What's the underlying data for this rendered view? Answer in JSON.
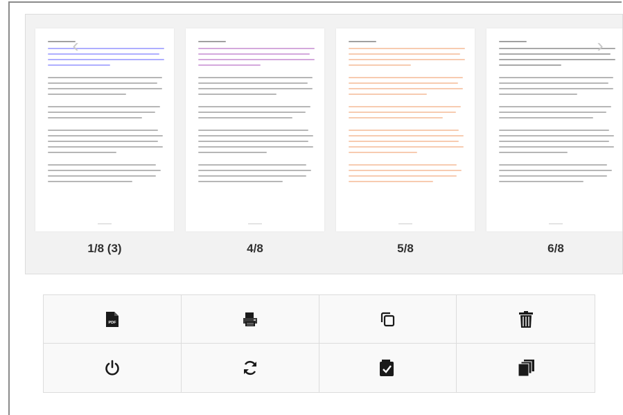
{
  "carousel": {
    "prev_arrow": "‹",
    "next_arrow": "›",
    "thumbnails": [
      {
        "label": "1/8 (3)",
        "tint": "#6c6cff"
      },
      {
        "label": "4/8",
        "tint": "#b060c0"
      },
      {
        "label": "5/8",
        "tint": "#f0a070"
      },
      {
        "label": "6/8",
        "tint": "#606060"
      }
    ]
  },
  "toolbar": {
    "buttons": [
      {
        "icon": "pdf-file-icon",
        "pdf_text": "PDF"
      },
      {
        "icon": "printer-icon"
      },
      {
        "icon": "copy-icon"
      },
      {
        "icon": "trash-icon"
      },
      {
        "icon": "power-icon"
      },
      {
        "icon": "refresh-icon"
      },
      {
        "icon": "checkbox-icon"
      },
      {
        "icon": "stack-icon"
      }
    ]
  },
  "colors": {
    "panel_bg": "#f2f2f2",
    "border": "#dcdcdc",
    "icon": "#1a1a1a"
  }
}
